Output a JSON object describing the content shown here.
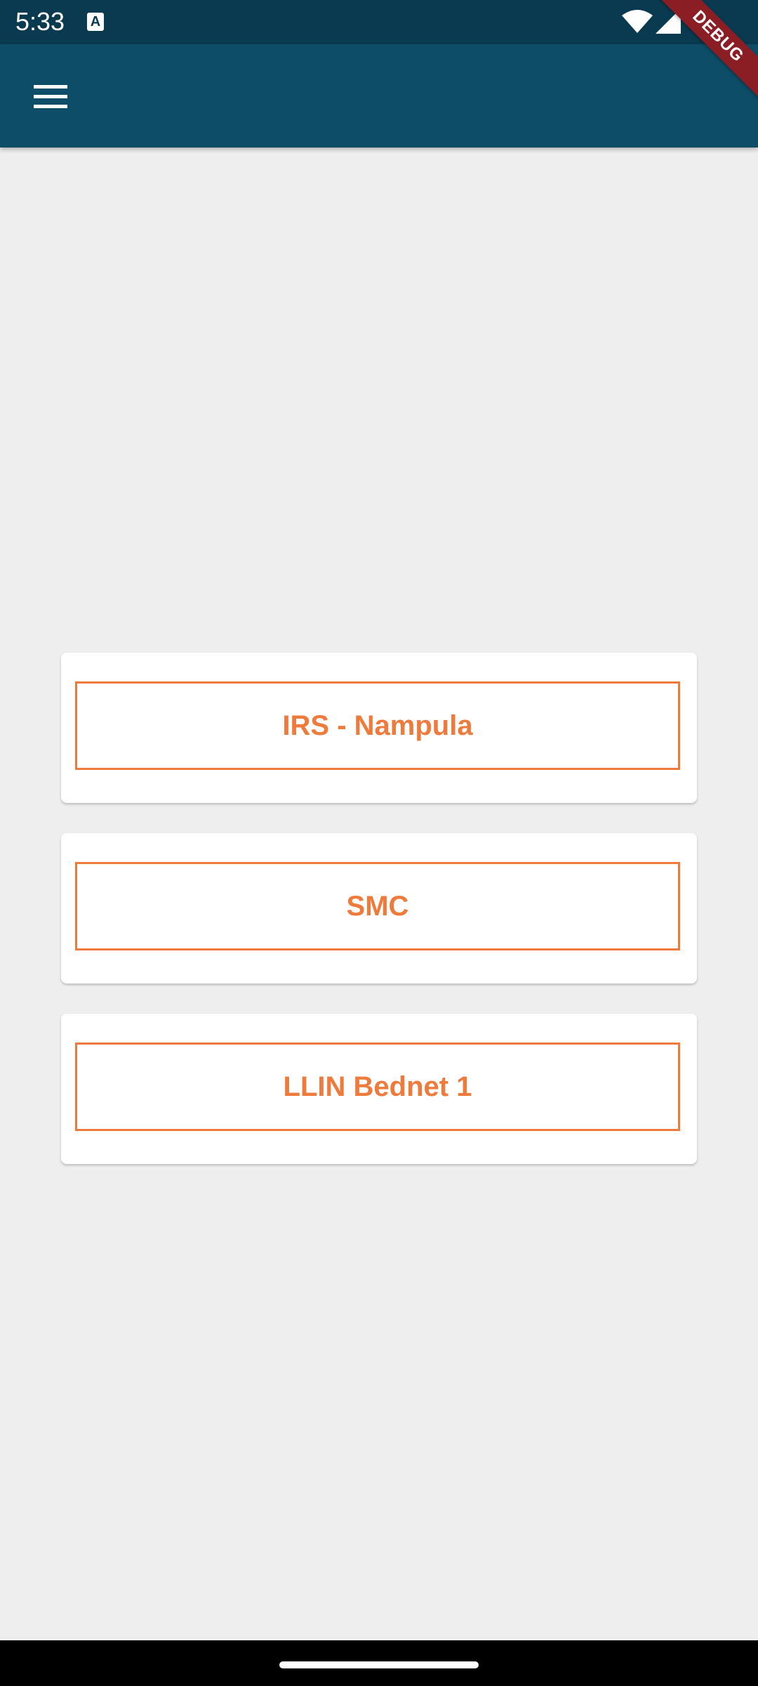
{
  "status_bar": {
    "time": "5:33",
    "notification_icon": "a-keyboard-icon",
    "icons": [
      "wifi-icon",
      "cellular-signal-icon"
    ]
  },
  "app_bar": {
    "menu_icon": "hamburger-menu-icon",
    "color": "#0e4d68"
  },
  "debug_banner": {
    "label": "DEBUG",
    "color": "#8a1e24"
  },
  "menu_cards": [
    {
      "label": "IRS - Nampula"
    },
    {
      "label": "SMC"
    },
    {
      "label": "LLIN Bednet 1"
    }
  ],
  "colors": {
    "accent": "#ee7a3b",
    "status_bar": "#0a3a50",
    "background": "#eeeeee"
  }
}
